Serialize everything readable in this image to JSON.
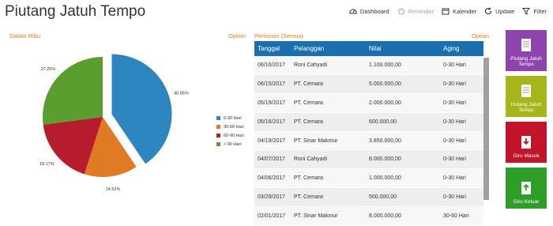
{
  "header": {
    "title": "Piutang Jatuh Tempo"
  },
  "toolbar": {
    "dashboard": "Dashboard",
    "reminder": "Reminder",
    "kalender": "Kalender",
    "update": "Update",
    "filter": "Filter"
  },
  "left_panel": {
    "label": "Dalam Ribu",
    "option": "Option"
  },
  "right_panel": {
    "label": "Perincian (Semua)",
    "option": "Option"
  },
  "chart_data": {
    "type": "pie",
    "categories": [
      "0-30 Hari",
      "30-60 Hari",
      "60-90 Hari",
      "> 90 Hari"
    ],
    "values": [
      40.85,
      14.52,
      18.17,
      27.25
    ],
    "labels": [
      "40.85%",
      "14.52%",
      "18.17%",
      "27.25%"
    ],
    "colors": [
      "#2e86c1",
      "#e07b24",
      "#b71c2e",
      "#5a9e2f"
    ],
    "exploded": "0-30 Hari",
    "legend": "right"
  },
  "table": {
    "headers": [
      "Tanggal",
      "Pelanggan",
      "Nilai",
      "Aging"
    ],
    "rows": [
      [
        "06/16/2017",
        "Roni Cahyadi",
        "1.100.000,00",
        "0-30 Hari"
      ],
      [
        "06/15/2017",
        "PT. Cemara",
        "5.000.000,00",
        "0-30 Hari"
      ],
      [
        "05/19/2017",
        "PT. Cemara",
        "2.000.000,00",
        "0-30 Hari"
      ],
      [
        "05/16/2017",
        "PT. Cemara",
        "600.000,00",
        "0-30 Hari"
      ],
      [
        "04/19/2017",
        "PT. Sinar Makmur",
        "3.850.000,00",
        "0-30 Hari"
      ],
      [
        "04/07/2017",
        "Roni Cahyadi",
        "8.000.000,00",
        "0-30 Hari"
      ],
      [
        "04/06/2017",
        "PT. Cemara",
        "1.000.000,00",
        "0-30 Hari"
      ],
      [
        "03/29/2017",
        "PT. Cemara",
        "500.000,00",
        "0-30 Hari"
      ],
      [
        "02/01/2017",
        "PT. Sinar Makmur",
        "8.000.000,00",
        "30-60 Hari"
      ]
    ]
  },
  "tiles": [
    {
      "label": "Piutang Jatuh\nTempo",
      "color": "#8e44ad",
      "icon": "document-icon"
    },
    {
      "label": "Hutang Jatuh\nTempo",
      "color": "#a6b51a",
      "icon": "document-icon"
    },
    {
      "label": "Giro Masuk",
      "color": "#c0152a",
      "icon": "download-icon"
    },
    {
      "label": "Giro Keluar",
      "color": "#2e9e28",
      "icon": "upload-icon"
    }
  ]
}
